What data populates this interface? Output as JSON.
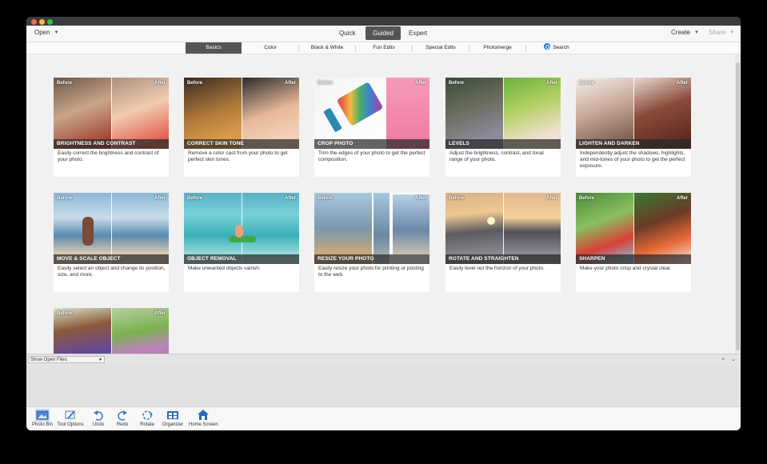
{
  "window": {
    "controls": [
      "close",
      "minimize",
      "zoom"
    ]
  },
  "topbar": {
    "open_label": "Open",
    "modes": [
      {
        "label": "Quick",
        "active": false
      },
      {
        "label": "Guided",
        "active": true
      },
      {
        "label": "Expert",
        "active": false
      }
    ],
    "create_label": "Create",
    "share_label": "Share"
  },
  "subtabs": [
    {
      "label": "Basics",
      "active": true
    },
    {
      "label": "Color",
      "active": false
    },
    {
      "label": "Black & White",
      "active": false
    },
    {
      "label": "Fun Edits",
      "active": false
    },
    {
      "label": "Special Edits",
      "active": false
    },
    {
      "label": "Photomerge",
      "active": false
    }
  ],
  "search_label": "Search",
  "cards": [
    {
      "title": "BRIGHTNESS AND CONTRAST",
      "before": "Before",
      "after": "After",
      "desc": "Easily correct the brightness and contrast of your photo."
    },
    {
      "title": "CORRECT SKIN TONE",
      "before": "Before",
      "after": "After",
      "desc": "Remove a color cast from your photo to get perfect skin tones."
    },
    {
      "title": "CROP PHOTO",
      "before": "Before",
      "after": "After",
      "desc": "Trim the edges of your photo to get the perfect composition."
    },
    {
      "title": "LEVELS",
      "before": "Before",
      "after": "After",
      "desc": "Adjust the brightness, contrast, and tonal range of your photo."
    },
    {
      "title": "LIGHTEN AND DARKEN",
      "before": "Before",
      "after": "After",
      "desc": "Independently adjust the shadows, highlights, and mid-tones of your photo to get the perfect exposure."
    },
    {
      "title": "MOVE & SCALE OBJECT",
      "before": "Before",
      "after": "After",
      "desc": "Easily select an object and change its position, size, and more."
    },
    {
      "title": "OBJECT REMOVAL",
      "before": "Before",
      "after": "After",
      "desc": "Make unwanted objects vanish."
    },
    {
      "title": "RESIZE YOUR PHOTO",
      "before": "Before",
      "after": "After",
      "desc": "Easily resize your photo for printing or posting to the web."
    },
    {
      "title": "ROTATE AND STRAIGHTEN",
      "before": "Before",
      "after": "After",
      "desc": "Easily level out the horizon of your photo."
    },
    {
      "title": "SHARPEN",
      "before": "Before",
      "after": "After",
      "desc": "Make your photo crisp and crystal clear."
    },
    {
      "title": "",
      "before": "Before",
      "after": "After",
      "desc": ""
    }
  ],
  "panel": {
    "open_files_label": "Show Open Files"
  },
  "bottombar": [
    {
      "label": "Photo Bin",
      "icon": "photo-bin-icon",
      "active": true
    },
    {
      "label": "Tool Options",
      "icon": "tool-options-icon",
      "active": false
    },
    {
      "label": "Undo",
      "icon": "undo-icon",
      "active": false
    },
    {
      "label": "Redo",
      "icon": "redo-icon",
      "active": false
    },
    {
      "label": "Rotate",
      "icon": "rotate-icon",
      "active": false
    },
    {
      "label": "Organizer",
      "icon": "organizer-icon",
      "active": false
    },
    {
      "label": "Home Screen",
      "icon": "home-screen-icon",
      "active": false
    }
  ]
}
